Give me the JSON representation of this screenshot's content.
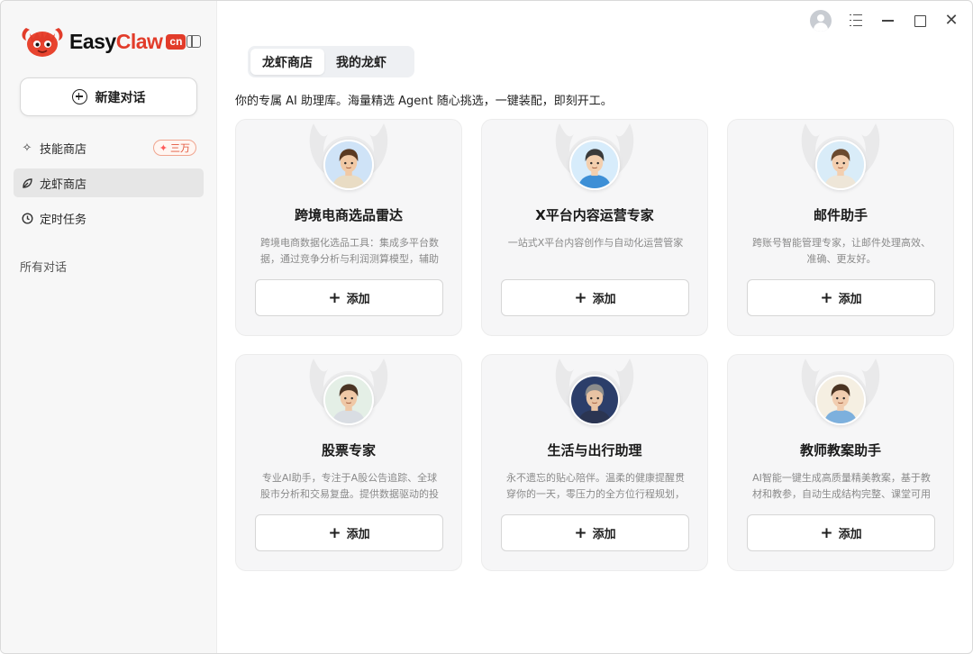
{
  "app": {
    "logo_text_a": "Easy",
    "logo_text_b": "Claw",
    "logo_badge": "cn"
  },
  "sidebar": {
    "new_chat_label": "新建对话",
    "items": [
      {
        "label": "技能商店",
        "icon": "sparkle-icon",
        "badge": "三万"
      },
      {
        "label": "龙虾商店",
        "icon": "leaf-icon"
      },
      {
        "label": "定时任务",
        "icon": "clock-icon"
      }
    ],
    "section_label": "所有对话"
  },
  "tabs": [
    {
      "label": "龙虾商店",
      "active": true
    },
    {
      "label": "我的龙虾",
      "active": false
    }
  ],
  "intro": "你的专属 AI 助理库。海量精选 Agent 随心挑选，一键装配，即刻开工。",
  "cards": [
    {
      "title": "跨境电商选品雷达",
      "desc": "跨境电商数据化选品工具：集成多平台数据，通过竞争分析与利润测算模型，辅助卖家快速锁定潜力商品。",
      "add_label": "添加"
    },
    {
      "title": "X平台内容运营专家",
      "desc": "一站式X平台内容创作与自动化运营管家",
      "add_label": "添加"
    },
    {
      "title": "邮件助手",
      "desc": "跨账号智能管理专家，让邮件处理高效、准确、更友好。",
      "add_label": "添加"
    },
    {
      "title": "股票专家",
      "desc": "专业AI助手，专注于A股公告追踪、全球股市分析和交易复盘。提供数据驱动的投资决策支持。",
      "add_label": "添加"
    },
    {
      "title": "生活与出行助理",
      "desc": "永不遗忘的贴心陪伴。温柔的健康提醒贯穿你的一天，零压力的全方位行程规划，智能安排每一次出行。",
      "add_label": "添加"
    },
    {
      "title": "教师教案助手",
      "desc": "AI智能一键生成高质量精美教案，基于教材和教参，自动生成结构完整、课堂可用的教学设计。",
      "add_label": "添加"
    }
  ],
  "colors": {
    "brand": "#e23c2a",
    "sidebar_bg": "#f7f7f7",
    "card_bg": "#f6f6f7"
  }
}
